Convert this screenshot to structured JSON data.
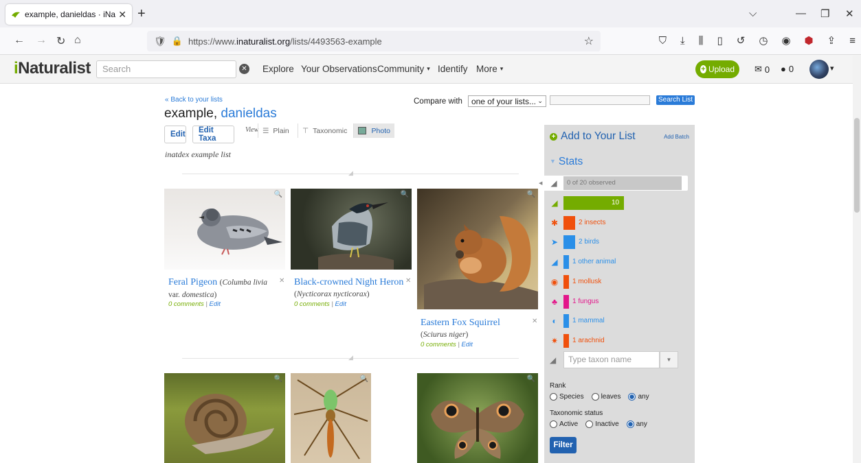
{
  "browser": {
    "tab_title": "example, danieldas · iNaturalist",
    "url_prefix": "https://www.",
    "url_host": "inaturalist.org",
    "url_path": "/lists/4493563-example",
    "colors": {
      "chrome": "#f0f0f4",
      "ublock": "#c1272d"
    }
  },
  "site": {
    "logo_i": "i",
    "logo_rest": "Naturalist",
    "search_placeholder": "Search",
    "nav": [
      "Explore",
      "Your Observations",
      "Community",
      "Identify",
      "More"
    ],
    "upload_label": "Upload",
    "messages_count": "0",
    "notifications_count": "0",
    "brand_color": "#74ac00"
  },
  "list": {
    "back_link": "« Back to your lists",
    "title_prefix": "example,",
    "owner": "danieldas",
    "compare_label": "Compare with",
    "compare_value": "one of your lists...",
    "search_button": "Search List",
    "edit_label": "Edit",
    "edit_taxa_label": "Edit Taxa",
    "view_label": "View",
    "view_options": [
      "Plain",
      "Taxonomic",
      "Photo"
    ],
    "description": "inatdex example list"
  },
  "species": [
    {
      "common": "Feral Pigeon",
      "sci": "Columba livia",
      "var_prefix": "var.",
      "var": "domestica",
      "comments": "0 comments",
      "edit": "Edit"
    },
    {
      "common": "Black-crowned Night Heron",
      "sci": "Nycticorax nycticorax",
      "comments": "0 comments",
      "edit": "Edit"
    },
    {
      "common": "Eastern Fox Squirrel",
      "sci": "Sciurus niger",
      "comments": "0 comments",
      "edit": "Edit"
    },
    {
      "common": "",
      "sci": "",
      "comments": "",
      "edit": ""
    },
    {
      "common": "",
      "sci": "",
      "comments": "",
      "edit": ""
    },
    {
      "common": "",
      "sci": "",
      "comments": "",
      "edit": ""
    }
  ],
  "sidebar": {
    "add_heading": "Add to Your List",
    "add_batch": "Add Batch",
    "stats_heading": "Stats",
    "total": "0 of 20 observed",
    "stats": [
      {
        "label": "10",
        "value": 10,
        "color": "#74ac00",
        "icon": "leaf-icon"
      },
      {
        "label": "2 insects",
        "value": 2,
        "color": "#f0500c",
        "icon": "insect-icon"
      },
      {
        "label": "2 birds",
        "value": 2,
        "color": "#2a8fe8",
        "icon": "bird-icon"
      },
      {
        "label": "1 other animal",
        "value": 1,
        "color": "#2a8fe8",
        "icon": "animal-icon"
      },
      {
        "label": "1 mollusk",
        "value": 1,
        "color": "#f0500c",
        "icon": "mollusk-icon"
      },
      {
        "label": "1 fungus",
        "value": 1,
        "color": "#e3168a",
        "icon": "fungus-icon"
      },
      {
        "label": "1 mammal",
        "value": 1,
        "color": "#2a8fe8",
        "icon": "mammal-icon"
      },
      {
        "label": "1 arachnid",
        "value": 1,
        "color": "#f0500c",
        "icon": "arachnid-icon"
      }
    ],
    "taxon_placeholder": "Type taxon name",
    "rank_label": "Rank",
    "rank_options": [
      "Species",
      "leaves",
      "any"
    ],
    "rank_selected": "any",
    "status_label": "Taxonomic status",
    "status_options": [
      "Active",
      "Inactive",
      "any"
    ],
    "status_selected": "any",
    "filter_label": "Filter"
  }
}
